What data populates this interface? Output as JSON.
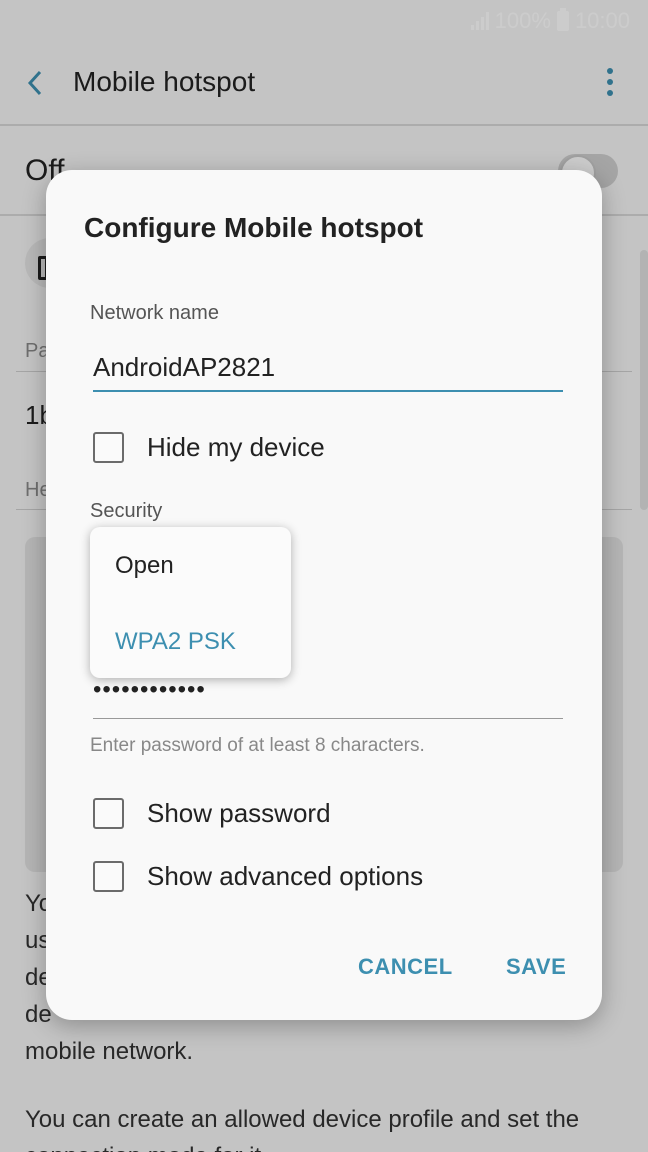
{
  "status": {
    "battery": "100%",
    "time": "10:00"
  },
  "appbar": {
    "title": "Mobile hotspot"
  },
  "master": {
    "label": "Off"
  },
  "background": {
    "password_label_partial": "Pa",
    "password_value_partial": "1b",
    "help_label_partial": "He",
    "para1": [
      "Yo",
      "us",
      "de",
      "de",
      "mobile network."
    ],
    "para2": "You can create an allowed device profile and set the",
    "para2_cont": "connection mode for it."
  },
  "dialog": {
    "title": "Configure Mobile hotspot",
    "network_name_label": "Network name",
    "network_name_value": "AndroidAP2821",
    "hide_device_label": "Hide my device",
    "security_label": "Security",
    "password_value": "••••••••••••",
    "password_hint": "Enter password of at least 8 characters.",
    "show_password_label": "Show password",
    "show_advanced_label": "Show advanced options",
    "cancel_label": "CANCEL",
    "save_label": "SAVE"
  },
  "security_dropdown": {
    "options": [
      {
        "label": "Open",
        "selected": false
      },
      {
        "label": "WPA2 PSK",
        "selected": true
      }
    ]
  },
  "colors": {
    "accent": "#3d8fb0",
    "text": "#222222",
    "hint": "#888888"
  }
}
